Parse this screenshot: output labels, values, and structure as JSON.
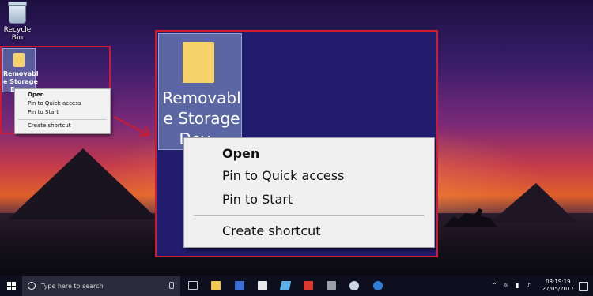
{
  "desktop": {
    "recycle_bin": {
      "line1": "Recycle",
      "line2": "Bin"
    },
    "drive": {
      "label_line1": "Removabl",
      "label_line2": "e Storage",
      "label_line3": "Dev..."
    }
  },
  "context_menu": {
    "items": [
      "Open",
      "Pin to Quick access",
      "Pin to Start",
      "Create shortcut"
    ]
  },
  "zoomed_menu": {
    "items": [
      "Open",
      "Pin to Quick access",
      "Pin to Start",
      "Create shortcut"
    ]
  },
  "zoomed_label": {
    "line1": "Removabl",
    "line2": "e Storage",
    "line3": "Dev..."
  },
  "taskbar": {
    "search_placeholder": "Type here to search",
    "time": "08:19:19",
    "date": "27/05/2017"
  },
  "colors": {
    "highlight_frame": "#d11a2a",
    "menu_bg": "#f0f0f0"
  }
}
